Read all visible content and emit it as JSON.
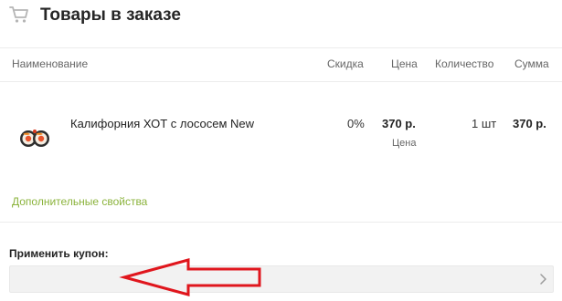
{
  "header": {
    "title": "Товары в заказе",
    "icon": "cart-icon"
  },
  "table": {
    "columns": {
      "name": "Наименование",
      "discount": "Скидка",
      "price": "Цена",
      "quantity": "Количество",
      "sum": "Сумма"
    },
    "rows": [
      {
        "name": "Калифорния ХОТ с лососем New",
        "discount": "0%",
        "price": "370 р.",
        "price_caption": "Цена",
        "quantity": "1 шт",
        "sum": "370 р."
      }
    ],
    "extra_properties_link": "Дополнительные свойства"
  },
  "coupon": {
    "label": "Применить купон:",
    "value": "",
    "placeholder": ""
  },
  "colors": {
    "accent_link": "#8bb33c",
    "annotation_arrow": "#e0161d",
    "input_background": "#f2f2f2",
    "divider": "#ececec"
  },
  "icons": {
    "cart": "cart-icon",
    "coupon_submit": "chevron-right-icon",
    "annotation": "arrow-left-annotation"
  }
}
